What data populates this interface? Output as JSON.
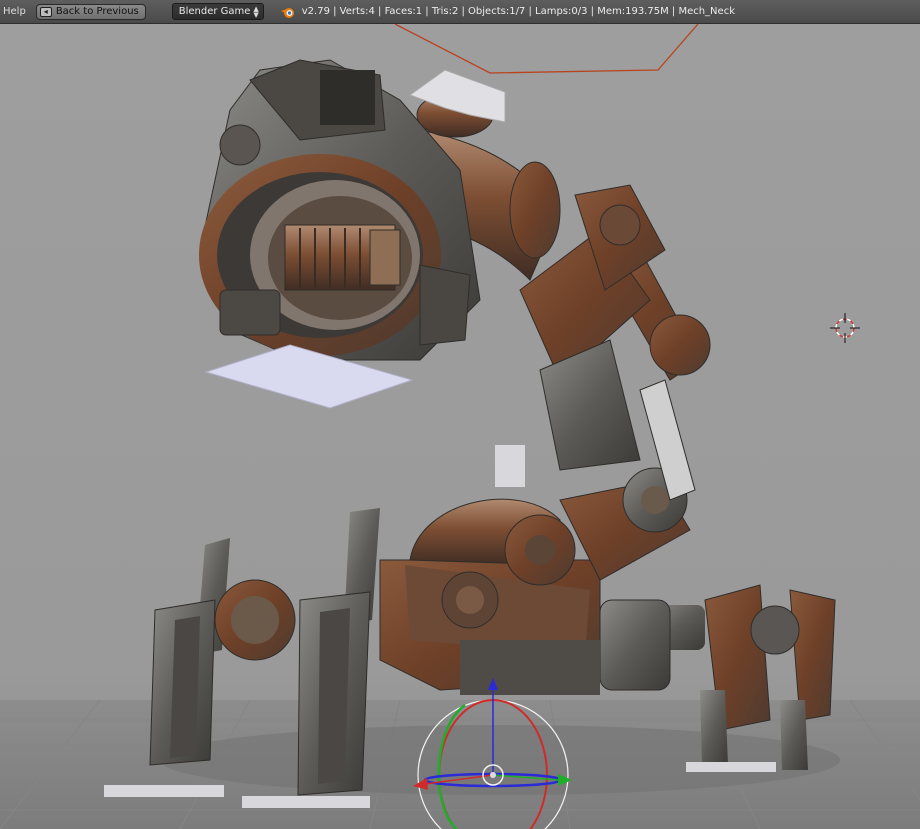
{
  "header": {
    "menu_help": "Help",
    "back_button": "Back to Previous",
    "engine_select": "Blender Game",
    "stats": "v2.79 | Verts:4 | Faces:1 | Tris:2 | Objects:1/7 | Lamps:0/3 | Mem:193.75M | Mech_Neck"
  },
  "viewport": {
    "object_name": "Mech_Neck",
    "colors": {
      "background": "#9c9c9c",
      "rust": "#7a4a30",
      "metal": "#5a5a58",
      "selection": "#b8431d"
    }
  }
}
